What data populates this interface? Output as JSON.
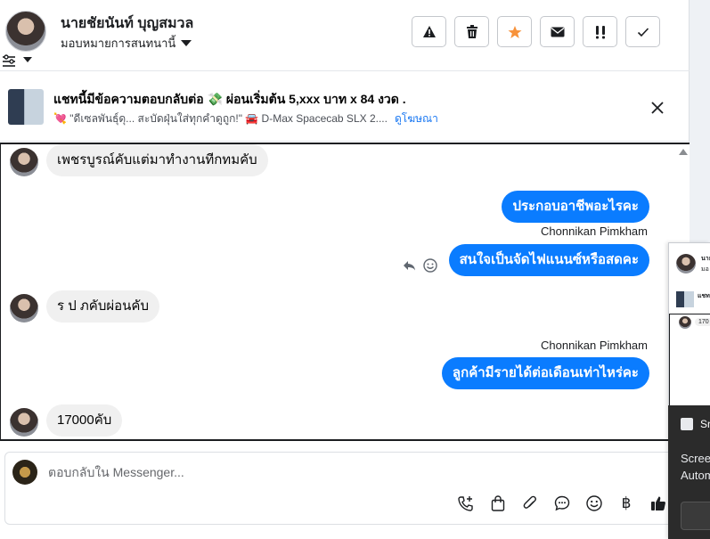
{
  "header": {
    "contact_name": "นายชัยนันท์ บุญสมวล",
    "assign_label": "มอบหมายการสนทนานี้",
    "actions": [
      {
        "name": "report-spam-button",
        "icon": "warning-triangle-icon"
      },
      {
        "name": "delete-button",
        "icon": "trash-icon"
      },
      {
        "name": "star-button",
        "icon": "star-icon"
      },
      {
        "name": "mark-unread-button",
        "icon": "envelope-icon"
      },
      {
        "name": "follow-up-button",
        "icon": "exclamation-icon"
      },
      {
        "name": "mark-done-button",
        "icon": "checkmark-icon"
      }
    ],
    "star_color": "#f7923a"
  },
  "banner": {
    "title": "แชทนี้มีข้อความตอบกลับต่อ 💸 ผ่อนเริ่มต้น 5,xxx บาท x 84 งวด .",
    "subtitle": "💘 \"ดีเซลพันธุ์ดุ... สะบัดฝุ่นใส่ทุกคำดูถูก!\" 🚘 D-Max Spacecab SLX 2....",
    "link": "ดูโฆษณา"
  },
  "messages": [
    {
      "type": "in",
      "text": "เพชรบูรณ์คับแต่มาทำงานทีกทมคับ"
    },
    {
      "type": "out",
      "text": "ประกอบอาชีพอะไรคะ"
    },
    {
      "type": "sender",
      "text": "Chonnikan Pimkham"
    },
    {
      "type": "out",
      "text": "สนใจเป็นจัดไฟแนนซ์หรือสดคะ"
    },
    {
      "type": "in",
      "text": "ร ป ภคับผ่อนคับ"
    },
    {
      "type": "sender",
      "text": "Chonnikan Pimkham"
    },
    {
      "type": "out",
      "text": "ลูกค้ามีรายได้ต่อเดือนเท่าไหร่คะ"
    },
    {
      "type": "in",
      "text": "17000คับ"
    }
  ],
  "composer": {
    "placeholder": "ตอบกลับใน Messenger...",
    "tools": [
      {
        "name": "call-button",
        "glyph": "📞"
      },
      {
        "name": "shop-button",
        "glyph": "🛍"
      },
      {
        "name": "attach-button",
        "glyph": "📎"
      },
      {
        "name": "saved-replies-button",
        "glyph": "💬"
      },
      {
        "name": "emoji-button",
        "glyph": "☺"
      },
      {
        "name": "payment-button",
        "glyph": "฿"
      },
      {
        "name": "like-button",
        "glyph": "👍"
      }
    ]
  },
  "mini_window": {
    "name_fragment": "นาย",
    "sub_fragment": "มอ",
    "banner_fragment": "แชท",
    "message_fragment": "170"
  },
  "notification": {
    "title": "Sn",
    "body_line1": "Scree",
    "body_line2": "Autom"
  },
  "colors": {
    "accent": "#0a7cff",
    "link": "#1877f2",
    "incoming_bubble": "#f0f0f0"
  }
}
